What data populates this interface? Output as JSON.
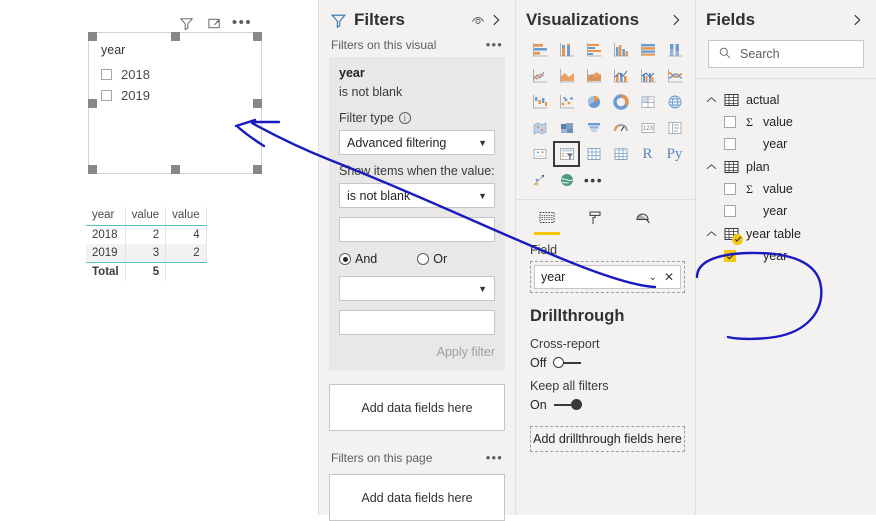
{
  "canvas": {
    "visual_header_icons": [
      "filter-icon",
      "focus-mode-icon",
      "more-options-icon"
    ],
    "slicer": {
      "title": "year",
      "items": [
        {
          "label": "2018",
          "checked": false
        },
        {
          "label": "2019",
          "checked": false
        }
      ]
    },
    "table_visual": {
      "columns": [
        "year",
        "value",
        "value"
      ],
      "rows": [
        [
          "2018",
          "2",
          "4"
        ],
        [
          "2019",
          "3",
          "2"
        ]
      ],
      "total_row": [
        "Total",
        "5",
        ""
      ]
    }
  },
  "filters": {
    "title": "Filters",
    "eye_icon": "eye-icon",
    "expand_icon": "chevron-right-icon",
    "visual_section_label": "Filters on this visual",
    "card": {
      "field": "year",
      "condition": "is not blank",
      "filter_type_label": "Filter type",
      "filter_type_value": "Advanced filtering",
      "show_items_label": "Show items when the value:",
      "operator_value": "is not blank",
      "operand_value": "",
      "and_label": "And",
      "or_label": "Or",
      "logic_selected": "And",
      "operator2_value": "",
      "operand2_value": "",
      "apply_label": "Apply filter"
    },
    "visual_dropzone": "Add data fields here",
    "page_section_label": "Filters on this page",
    "page_dropzone": "Add data fields here"
  },
  "visualizations": {
    "title": "Visualizations",
    "expand_icon": "chevron-right-icon",
    "gallery": [
      {
        "name": "stacked-bar-chart-icon",
        "selected": false
      },
      {
        "name": "stacked-column-chart-icon",
        "selected": false
      },
      {
        "name": "clustered-bar-chart-icon",
        "selected": false
      },
      {
        "name": "clustered-column-chart-icon",
        "selected": false
      },
      {
        "name": "hundred-percent-stacked-bar-chart-icon",
        "selected": false
      },
      {
        "name": "hundred-percent-stacked-column-chart-icon",
        "selected": false
      },
      {
        "name": "line-chart-icon",
        "selected": false
      },
      {
        "name": "area-chart-icon",
        "selected": false
      },
      {
        "name": "stacked-area-chart-icon",
        "selected": false
      },
      {
        "name": "line-and-stacked-column-chart-icon",
        "selected": false
      },
      {
        "name": "line-and-clustered-column-chart-icon",
        "selected": false
      },
      {
        "name": "ribbon-chart-icon",
        "selected": false
      },
      {
        "name": "waterfall-chart-icon",
        "selected": false
      },
      {
        "name": "scatter-chart-icon",
        "selected": false
      },
      {
        "name": "pie-chart-icon",
        "selected": false
      },
      {
        "name": "donut-chart-icon",
        "selected": false
      },
      {
        "name": "treemap-icon",
        "selected": false
      },
      {
        "name": "map-icon",
        "selected": false
      },
      {
        "name": "filled-map-icon",
        "selected": false
      },
      {
        "name": "shape-map-icon",
        "selected": false
      },
      {
        "name": "funnel-chart-icon",
        "selected": false
      },
      {
        "name": "gauge-icon",
        "selected": false
      },
      {
        "name": "card-icon",
        "selected": false
      },
      {
        "name": "multi-row-card-icon",
        "selected": false
      },
      {
        "name": "kpi-icon",
        "selected": false
      },
      {
        "name": "slicer-icon",
        "selected": true
      },
      {
        "name": "table-icon",
        "selected": false
      },
      {
        "name": "matrix-icon",
        "selected": false
      },
      {
        "name": "r-script-visual-icon",
        "label": "R",
        "selected": false
      },
      {
        "name": "python-visual-icon",
        "label": "Py",
        "selected": false
      },
      {
        "name": "key-influencers-icon",
        "selected": false
      },
      {
        "name": "arcgis-maps-icon",
        "selected": false
      },
      {
        "name": "more-visuals-icon",
        "selected": false
      }
    ],
    "tabs": [
      {
        "name": "fields-tab",
        "icon": "fields-pane-icon",
        "active": true
      },
      {
        "name": "format-tab",
        "icon": "paint-roller-icon",
        "active": false
      },
      {
        "name": "analytics-tab",
        "icon": "magnifier-chart-icon",
        "active": false
      }
    ],
    "field_well_label": "Field",
    "field_chip": "year",
    "drillthrough": {
      "title": "Drillthrough",
      "cross_report_label": "Cross-report",
      "cross_report_state": "Off",
      "keep_all_filters_label": "Keep all filters",
      "keep_all_filters_state": "On",
      "dropzone": "Add drillthrough fields here"
    }
  },
  "fields": {
    "title": "Fields",
    "expand_icon": "chevron-right-icon",
    "search_placeholder": "Search",
    "tables": [
      {
        "name": "actual",
        "expanded": true,
        "badge": false,
        "fields": [
          {
            "label": "value",
            "aggregate": "Σ",
            "checked": false
          },
          {
            "label": "year",
            "aggregate": "",
            "checked": false
          }
        ]
      },
      {
        "name": "plan",
        "expanded": true,
        "badge": false,
        "fields": [
          {
            "label": "value",
            "aggregate": "Σ",
            "checked": false
          },
          {
            "label": "year",
            "aggregate": "",
            "checked": false
          }
        ]
      },
      {
        "name": "year table",
        "expanded": true,
        "badge": true,
        "fields": [
          {
            "label": "year",
            "aggregate": "",
            "checked": true
          }
        ]
      }
    ]
  },
  "annotations": {
    "ink_color": "#1a1ac0",
    "arrow_label": "arrow-from-field-well-to-slicer",
    "circle_label": "circle-around-year-table"
  },
  "colors": {
    "accent_yellow": "#f2c811",
    "pane_bg": "#f3f2f1",
    "card_bg": "#e9e8e6",
    "ink": "#1a1ac0",
    "table_accent": "#5bc2b6"
  }
}
